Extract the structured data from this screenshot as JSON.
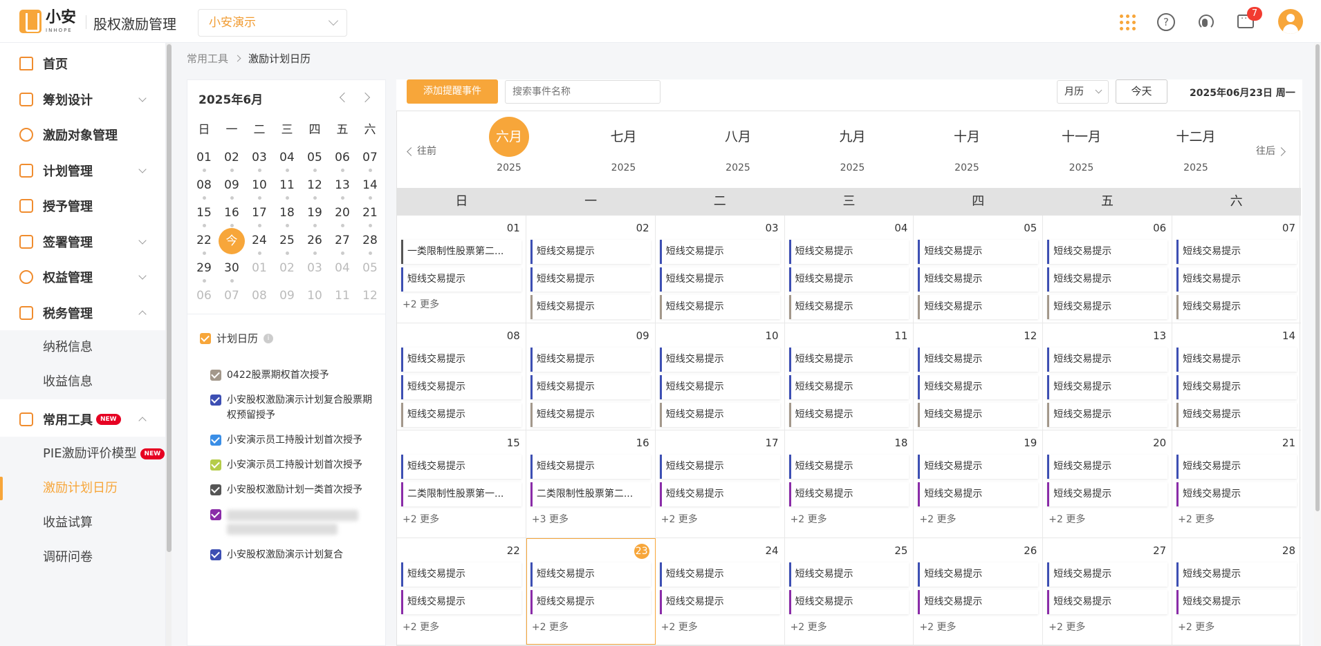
{
  "app": {
    "logo_cn": "小安",
    "logo_en": "INHOPE",
    "title": "股权激励管理",
    "tenant": "小安演示",
    "notification_count": "7"
  },
  "icons": {
    "apps": "grid-icon",
    "help": "help-icon",
    "service": "headset-icon",
    "messages": "message-icon",
    "user": "avatar-icon"
  },
  "colors": {
    "accent": "#f7a63a",
    "badge": "#f23b30",
    "new_tag": "#e60022"
  },
  "sidebar": {
    "items": [
      {
        "label": "首页",
        "icon": "home-icon"
      },
      {
        "label": "筹划设计",
        "icon": "edit-icon"
      },
      {
        "label": "激励对象管理",
        "icon": "users-icon"
      },
      {
        "label": "计划管理",
        "icon": "apps-icon"
      },
      {
        "label": "授予管理",
        "icon": "doc-icon"
      },
      {
        "label": "签署管理",
        "icon": "sign-icon"
      },
      {
        "label": "权益管理",
        "icon": "shield-icon"
      },
      {
        "label": "税务管理",
        "icon": "tax-icon"
      },
      {
        "label": "常用工具",
        "icon": "toolbox-icon",
        "tag": "NEW"
      }
    ],
    "tax_sub": [
      "纳税信息",
      "收益信息"
    ],
    "tools_sub": [
      {
        "label": "PIE激励评价模型",
        "tag": "NEW"
      },
      {
        "label": "激励计划日历"
      },
      {
        "label": "收益试算"
      },
      {
        "label": "调研问卷"
      }
    ]
  },
  "breadcrumb": {
    "parent": "常用工具",
    "current": "激励计划日历"
  },
  "mini_calendar": {
    "title": "2025年6月",
    "weekdays": [
      "日",
      "一",
      "二",
      "三",
      "四",
      "五",
      "六"
    ],
    "weeks": [
      [
        "01",
        "02",
        "03",
        "04",
        "05",
        "06",
        "07"
      ],
      [
        "08",
        "09",
        "10",
        "11",
        "12",
        "13",
        "14"
      ],
      [
        "15",
        "16",
        "17",
        "18",
        "19",
        "20",
        "21"
      ],
      [
        "22",
        "今",
        "24",
        "25",
        "26",
        "27",
        "28"
      ],
      [
        "29",
        "30",
        "01",
        "02",
        "03",
        "04",
        "05"
      ],
      [
        "06",
        "07",
        "08",
        "09",
        "10",
        "11",
        "12"
      ]
    ]
  },
  "plans": {
    "header": "计划日历",
    "items": [
      {
        "label": "0422股票期权首次授予",
        "color": "#a3988b"
      },
      {
        "label": "小安股权激励演示计划复合股票期权预留授予",
        "color": "#3d4fb3"
      },
      {
        "label": "小安演示员工持股计划首次授予",
        "color": "#3a8ee6"
      },
      {
        "label": "小安演示员工持股计划首次授予",
        "color": "#b5cc4a"
      },
      {
        "label": "小安股权激励计划一类首次授予",
        "color": "#555555"
      },
      {
        "label": "",
        "color": "#8a2ca8"
      },
      {
        "label": "小安股权激励演示计划复合",
        "color": "#3d4fb3"
      }
    ]
  },
  "toolbar": {
    "add_label": "添加提醒事件",
    "search_placeholder": "搜索事件名称",
    "view": "月历",
    "today": "今天",
    "current_date": "2025年06月23日 周一"
  },
  "month_strip": {
    "prev": "往前",
    "next": "往后",
    "months": [
      {
        "name": "六月",
        "year": "2025",
        "active": true
      },
      {
        "name": "七月",
        "year": "2025"
      },
      {
        "name": "八月",
        "year": "2025"
      },
      {
        "name": "九月",
        "year": "2025"
      },
      {
        "name": "十月",
        "year": "2025"
      },
      {
        "name": "十一月",
        "year": "2025"
      },
      {
        "name": "十二月",
        "year": "2025"
      }
    ]
  },
  "calendar": {
    "weekdays": [
      "日",
      "一",
      "二",
      "三",
      "四",
      "五",
      "六"
    ],
    "weeks": [
      [
        {
          "day": "01",
          "events": [
            {
              "t": "一类限制性股票第二...",
              "c": "#555555"
            },
            {
              "t": "短线交易提示",
              "c": "#3d4fb3"
            }
          ],
          "more": "+2 更多"
        },
        {
          "day": "02",
          "events": [
            {
              "t": "短线交易提示",
              "c": "#3d4fb3"
            },
            {
              "t": "短线交易提示",
              "c": "#3d4fb3"
            },
            {
              "t": "短线交易提示",
              "c": "#a3988b"
            }
          ]
        },
        {
          "day": "03",
          "events": [
            {
              "t": "短线交易提示",
              "c": "#3d4fb3"
            },
            {
              "t": "短线交易提示",
              "c": "#3d4fb3"
            },
            {
              "t": "短线交易提示",
              "c": "#a3988b"
            }
          ]
        },
        {
          "day": "04",
          "events": [
            {
              "t": "短线交易提示",
              "c": "#3d4fb3"
            },
            {
              "t": "短线交易提示",
              "c": "#3d4fb3"
            },
            {
              "t": "短线交易提示",
              "c": "#a3988b"
            }
          ]
        },
        {
          "day": "05",
          "events": [
            {
              "t": "短线交易提示",
              "c": "#3d4fb3"
            },
            {
              "t": "短线交易提示",
              "c": "#3d4fb3"
            },
            {
              "t": "短线交易提示",
              "c": "#a3988b"
            }
          ]
        },
        {
          "day": "06",
          "events": [
            {
              "t": "短线交易提示",
              "c": "#3d4fb3"
            },
            {
              "t": "短线交易提示",
              "c": "#3d4fb3"
            },
            {
              "t": "短线交易提示",
              "c": "#a3988b"
            }
          ]
        },
        {
          "day": "07",
          "events": [
            {
              "t": "短线交易提示",
              "c": "#3d4fb3"
            },
            {
              "t": "短线交易提示",
              "c": "#3d4fb3"
            },
            {
              "t": "短线交易提示",
              "c": "#a3988b"
            }
          ]
        }
      ],
      [
        {
          "day": "08",
          "events": [
            {
              "t": "短线交易提示",
              "c": "#3d4fb3"
            },
            {
              "t": "短线交易提示",
              "c": "#3d4fb3"
            },
            {
              "t": "短线交易提示",
              "c": "#a3988b"
            }
          ]
        },
        {
          "day": "09",
          "events": [
            {
              "t": "短线交易提示",
              "c": "#3d4fb3"
            },
            {
              "t": "短线交易提示",
              "c": "#3d4fb3"
            },
            {
              "t": "短线交易提示",
              "c": "#a3988b"
            }
          ]
        },
        {
          "day": "10",
          "events": [
            {
              "t": "短线交易提示",
              "c": "#3d4fb3"
            },
            {
              "t": "短线交易提示",
              "c": "#3d4fb3"
            },
            {
              "t": "短线交易提示",
              "c": "#a3988b"
            }
          ]
        },
        {
          "day": "11",
          "events": [
            {
              "t": "短线交易提示",
              "c": "#3d4fb3"
            },
            {
              "t": "短线交易提示",
              "c": "#3d4fb3"
            },
            {
              "t": "短线交易提示",
              "c": "#a3988b"
            }
          ]
        },
        {
          "day": "12",
          "events": [
            {
              "t": "短线交易提示",
              "c": "#3d4fb3"
            },
            {
              "t": "短线交易提示",
              "c": "#3d4fb3"
            },
            {
              "t": "短线交易提示",
              "c": "#a3988b"
            }
          ]
        },
        {
          "day": "13",
          "events": [
            {
              "t": "短线交易提示",
              "c": "#3d4fb3"
            },
            {
              "t": "短线交易提示",
              "c": "#3d4fb3"
            },
            {
              "t": "短线交易提示",
              "c": "#a3988b"
            }
          ]
        },
        {
          "day": "14",
          "events": [
            {
              "t": "短线交易提示",
              "c": "#3d4fb3"
            },
            {
              "t": "短线交易提示",
              "c": "#3d4fb3"
            },
            {
              "t": "短线交易提示",
              "c": "#a3988b"
            }
          ]
        }
      ],
      [
        {
          "day": "15",
          "events": [
            {
              "t": "短线交易提示",
              "c": "#3d4fb3"
            },
            {
              "t": "二类限制性股票第一...",
              "c": "#8a2ca8"
            }
          ],
          "more": "+2 更多"
        },
        {
          "day": "16",
          "events": [
            {
              "t": "短线交易提示",
              "c": "#3d4fb3"
            },
            {
              "t": "二类限制性股票第二...",
              "c": "#8a2ca8"
            }
          ],
          "more": "+3 更多"
        },
        {
          "day": "17",
          "events": [
            {
              "t": "短线交易提示",
              "c": "#3d4fb3"
            },
            {
              "t": "短线交易提示",
              "c": "#8a2ca8"
            }
          ],
          "more": "+2 更多"
        },
        {
          "day": "18",
          "events": [
            {
              "t": "短线交易提示",
              "c": "#3d4fb3"
            },
            {
              "t": "短线交易提示",
              "c": "#8a2ca8"
            }
          ],
          "more": "+2 更多"
        },
        {
          "day": "19",
          "events": [
            {
              "t": "短线交易提示",
              "c": "#3d4fb3"
            },
            {
              "t": "短线交易提示",
              "c": "#8a2ca8"
            }
          ],
          "more": "+2 更多"
        },
        {
          "day": "20",
          "events": [
            {
              "t": "短线交易提示",
              "c": "#3d4fb3"
            },
            {
              "t": "短线交易提示",
              "c": "#8a2ca8"
            }
          ],
          "more": "+2 更多"
        },
        {
          "day": "21",
          "events": [
            {
              "t": "短线交易提示",
              "c": "#3d4fb3"
            },
            {
              "t": "短线交易提示",
              "c": "#8a2ca8"
            }
          ],
          "more": "+2 更多"
        }
      ],
      [
        {
          "day": "22",
          "events": [
            {
              "t": "短线交易提示",
              "c": "#3d4fb3"
            },
            {
              "t": "短线交易提示",
              "c": "#8a2ca8"
            }
          ],
          "more": "+2 更多"
        },
        {
          "day": "23",
          "today": true,
          "events": [
            {
              "t": "短线交易提示",
              "c": "#3d4fb3"
            },
            {
              "t": "短线交易提示",
              "c": "#8a2ca8"
            }
          ],
          "more": "+2 更多"
        },
        {
          "day": "24",
          "events": [
            {
              "t": "短线交易提示",
              "c": "#3d4fb3"
            },
            {
              "t": "短线交易提示",
              "c": "#8a2ca8"
            }
          ],
          "more": "+2 更多"
        },
        {
          "day": "25",
          "events": [
            {
              "t": "短线交易提示",
              "c": "#3d4fb3"
            },
            {
              "t": "短线交易提示",
              "c": "#8a2ca8"
            }
          ],
          "more": "+2 更多"
        },
        {
          "day": "26",
          "events": [
            {
              "t": "短线交易提示",
              "c": "#3d4fb3"
            },
            {
              "t": "短线交易提示",
              "c": "#8a2ca8"
            }
          ],
          "more": "+2 更多"
        },
        {
          "day": "27",
          "events": [
            {
              "t": "短线交易提示",
              "c": "#3d4fb3"
            },
            {
              "t": "短线交易提示",
              "c": "#8a2ca8"
            }
          ],
          "more": "+2 更多"
        },
        {
          "day": "28",
          "events": [
            {
              "t": "短线交易提示",
              "c": "#3d4fb3"
            },
            {
              "t": "短线交易提示",
              "c": "#8a2ca8"
            }
          ],
          "more": "+2 更多"
        }
      ]
    ]
  }
}
